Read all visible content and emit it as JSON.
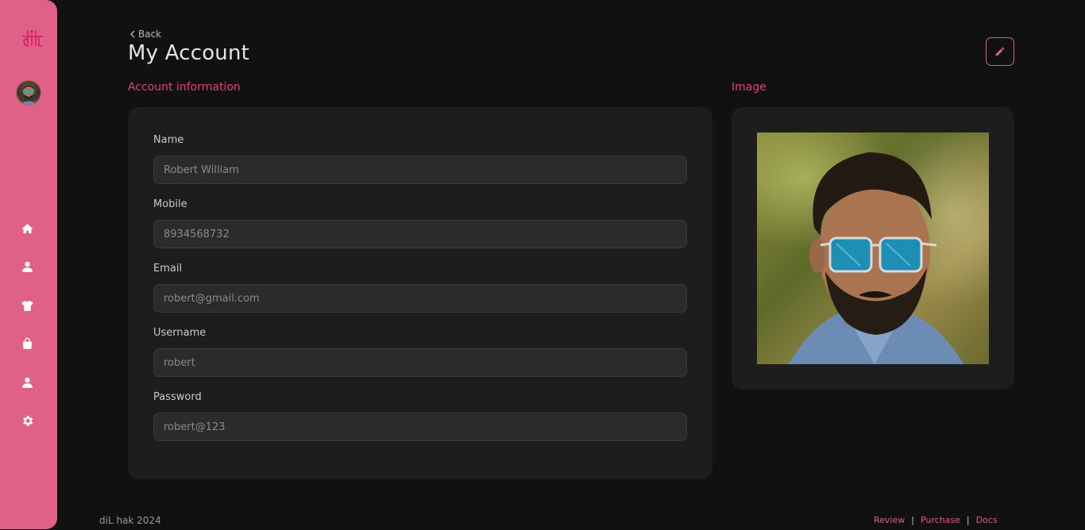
{
  "sidebar": {
    "logo_icon": "dil-logo-icon",
    "avatar_icon": "user-avatar",
    "nav": [
      {
        "icon": "home-icon"
      },
      {
        "icon": "user-icon"
      },
      {
        "icon": "tshirt-icon"
      },
      {
        "icon": "shopping-bag-icon"
      },
      {
        "icon": "account-icon"
      },
      {
        "icon": "gear-icon"
      }
    ],
    "accent_color": "#e06188"
  },
  "header": {
    "back_label": "Back",
    "title": "My Account",
    "edit_icon": "pencil-icon"
  },
  "account_section": {
    "label": "Account information",
    "fields": [
      {
        "label": "Name",
        "value": "Robert William"
      },
      {
        "label": "Mobile",
        "value": "8934568732"
      },
      {
        "label": "Email",
        "value": "robert@gmail.com"
      },
      {
        "label": "Username",
        "value": "robert"
      },
      {
        "label": "Password",
        "value": "robert@123"
      }
    ]
  },
  "image_section": {
    "label": "Image"
  },
  "footer": {
    "copyright": "diL hak 2024",
    "links": [
      "Review",
      "Purchase",
      "Docs"
    ],
    "separator": "|"
  },
  "colors": {
    "background": "#111111",
    "card": "#1d1d1d",
    "accent": "#e5436f"
  }
}
